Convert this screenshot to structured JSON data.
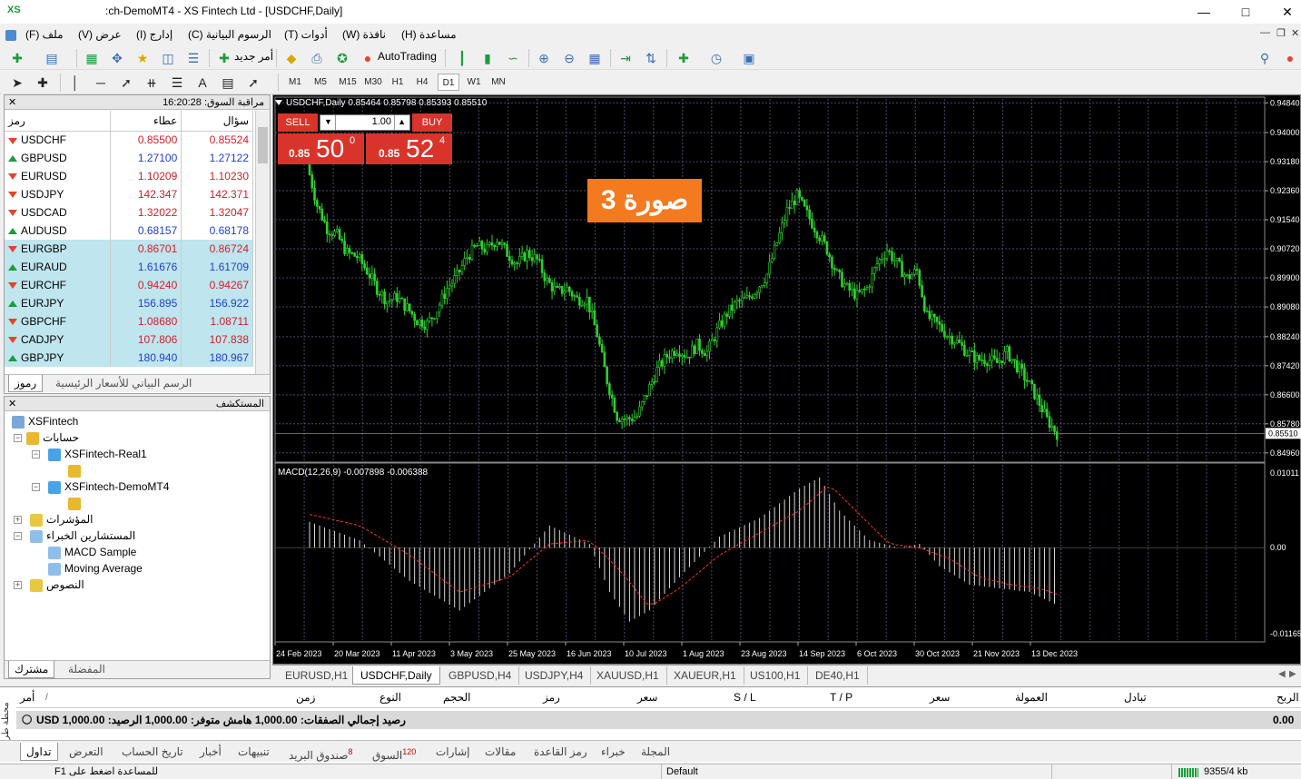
{
  "window": {
    "logo": "XS",
    "title": ":ch-DemoMT4 - XS Fintech Ltd - [USDCHF,Daily]"
  },
  "menu": [
    "ملف (F)",
    "عرض (V)",
    "إدارج (I)",
    "الرسوم البيانية (C)",
    "أدوات (T)",
    "نافذة (W)",
    "مساعدة (H)"
  ],
  "toolbar": {
    "new_order": "أمر جديد",
    "autotrading": "AutoTrading",
    "timeframes": [
      "M1",
      "M5",
      "M15",
      "M30",
      "H1",
      "H4",
      "D1",
      "W1",
      "MN"
    ],
    "active_timeframe": "D1"
  },
  "market_watch": {
    "title": "مراقبة السوق: 16:20:28",
    "headers": {
      "symbol": "رمز",
      "bid": "عطاء",
      "ask": "سؤال"
    },
    "rows": [
      {
        "symbol": "USDCHF",
        "bid": "0.85500",
        "ask": "0.85524",
        "dir": "down",
        "color": "red"
      },
      {
        "symbol": "GBPUSD",
        "bid": "1.27100",
        "ask": "1.27122",
        "dir": "up",
        "color": "blue"
      },
      {
        "symbol": "EURUSD",
        "bid": "1.10209",
        "ask": "1.10230",
        "dir": "down",
        "color": "red"
      },
      {
        "symbol": "USDJPY",
        "bid": "142.347",
        "ask": "142.371",
        "dir": "down",
        "color": "red"
      },
      {
        "symbol": "USDCAD",
        "bid": "1.32022",
        "ask": "1.32047",
        "dir": "down",
        "color": "red"
      },
      {
        "symbol": "AUDUSD",
        "bid": "0.68157",
        "ask": "0.68178",
        "dir": "up",
        "color": "blue"
      },
      {
        "symbol": "EURGBP",
        "bid": "0.86701",
        "ask": "0.86724",
        "dir": "down",
        "color": "red"
      },
      {
        "symbol": "EURAUD",
        "bid": "1.61676",
        "ask": "1.61709",
        "dir": "up",
        "color": "blue"
      },
      {
        "symbol": "EURCHF",
        "bid": "0.94240",
        "ask": "0.94267",
        "dir": "down",
        "color": "red"
      },
      {
        "symbol": "EURJPY",
        "bid": "156.895",
        "ask": "156.922",
        "dir": "up",
        "color": "blue"
      },
      {
        "symbol": "GBPCHF",
        "bid": "1.08680",
        "ask": "1.08711",
        "dir": "down",
        "color": "red"
      },
      {
        "symbol": "CADJPY",
        "bid": "107.806",
        "ask": "107.838",
        "dir": "down",
        "color": "red"
      },
      {
        "symbol": "GBPJPY",
        "bid": "180.940",
        "ask": "180.967",
        "dir": "up",
        "color": "blue"
      }
    ],
    "tabs": [
      "رموز",
      "الرسم البياني للأسعار الرئيسية"
    ]
  },
  "navigator": {
    "title": "المستكشف",
    "root": "XSFintech",
    "accounts": "حسابات",
    "account1": "XSFintech-Real1",
    "account2": "XSFintech-DemoMT4",
    "indicators": "المؤشرات",
    "experts": "المستشارين الخبراء",
    "expert1": "MACD Sample",
    "expert2": "Moving Average",
    "scripts": "النصوص",
    "tabs": [
      "مشترك",
      "المفضلة"
    ]
  },
  "chart": {
    "info": "USDCHF,Daily  0.85464 0.85798 0.85393 0.85510",
    "sell_label": "SELL",
    "buy_label": "BUY",
    "lot": "1.00",
    "sell_prefix": "0.85",
    "sell_big": "50",
    "sell_sup": "0",
    "buy_prefix": "0.85",
    "buy_big": "52",
    "buy_sup": "4",
    "overlay_label": "صورة 3",
    "macd_label": "MACD(12,26,9) -0.007898 -0.006388",
    "current_price": "0.85510"
  },
  "chart_data": {
    "type": "candlestick",
    "symbol": "USDCHF",
    "timeframe": "Daily",
    "price_ticks": [
      "0.94840",
      "0.94000",
      "0.93180",
      "0.92360",
      "0.91540",
      "0.90720",
      "0.89900",
      "0.89080",
      "0.88240",
      "0.87420",
      "0.86600",
      "0.85780",
      "0.84960"
    ],
    "price_range": [
      0.8475,
      0.9495
    ],
    "macd_ticks": [
      "0.01011",
      "0.00",
      "-0.01165"
    ],
    "x_labels": [
      "24 Feb 2023",
      "20 Mar 2023",
      "11 Apr 2023",
      "3 May 2023",
      "25 May 2023",
      "16 Jun 2023",
      "10 Jul 2023",
      "1 Aug 2023",
      "23 Aug 2023",
      "14 Sep 2023",
      "6 Oct 2023",
      "30 Oct 2023",
      "21 Nov 2023",
      "13 Dec 2023"
    ],
    "close_path": [
      [
        0,
        0.931
      ],
      [
        4,
        0.9195
      ],
      [
        8,
        0.913
      ],
      [
        12,
        0.911
      ],
      [
        16,
        0.906
      ],
      [
        20,
        0.905
      ],
      [
        24,
        0.901
      ],
      [
        28,
        0.896
      ],
      [
        32,
        0.8925
      ],
      [
        36,
        0.8935
      ],
      [
        40,
        0.8905
      ],
      [
        44,
        0.887
      ],
      [
        48,
        0.886
      ],
      [
        52,
        0.89
      ],
      [
        56,
        0.896
      ],
      [
        60,
        0.8995
      ],
      [
        64,
        0.905
      ],
      [
        68,
        0.908
      ],
      [
        72,
        0.907
      ],
      [
        76,
        0.91
      ],
      [
        80,
        0.906
      ],
      [
        84,
        0.903
      ],
      [
        88,
        0.906
      ],
      [
        92,
        0.904
      ],
      [
        96,
        0.898
      ],
      [
        100,
        0.895
      ],
      [
        104,
        0.896
      ],
      [
        108,
        0.893
      ],
      [
        112,
        0.893
      ],
      [
        116,
        0.883
      ],
      [
        120,
        0.87
      ],
      [
        124,
        0.86
      ],
      [
        128,
        0.859
      ],
      [
        132,
        0.86
      ],
      [
        136,
        0.8665
      ],
      [
        140,
        0.873
      ],
      [
        144,
        0.877
      ],
      [
        148,
        0.879
      ],
      [
        152,
        0.877
      ],
      [
        156,
        0.88
      ],
      [
        160,
        0.878
      ],
      [
        164,
        0.884
      ],
      [
        168,
        0.889
      ],
      [
        172,
        0.892
      ],
      [
        176,
        0.893
      ],
      [
        180,
        0.896
      ],
      [
        184,
        0.9
      ],
      [
        188,
        0.909
      ],
      [
        192,
        0.918
      ],
      [
        196,
        0.922
      ],
      [
        200,
        0.917
      ],
      [
        204,
        0.912
      ],
      [
        208,
        0.907
      ],
      [
        212,
        0.9
      ],
      [
        216,
        0.896
      ],
      [
        220,
        0.894
      ],
      [
        224,
        0.896
      ],
      [
        228,
        0.903
      ],
      [
        232,
        0.907
      ],
      [
        236,
        0.903
      ],
      [
        240,
        0.899
      ],
      [
        244,
        0.901
      ],
      [
        248,
        0.888
      ],
      [
        252,
        0.886
      ],
      [
        256,
        0.883
      ],
      [
        260,
        0.881
      ],
      [
        264,
        0.878
      ],
      [
        268,
        0.876
      ],
      [
        272,
        0.876
      ],
      [
        276,
        0.875
      ],
      [
        280,
        0.878
      ],
      [
        284,
        0.874
      ],
      [
        288,
        0.87
      ],
      [
        292,
        0.865
      ],
      [
        296,
        0.859
      ],
      [
        300,
        0.8551
      ]
    ],
    "macd_path": [
      [
        0,
        0.0035
      ],
      [
        20,
        0.001
      ],
      [
        40,
        -0.0045
      ],
      [
        60,
        -0.0085
      ],
      [
        80,
        -0.0035
      ],
      [
        96,
        0.003
      ],
      [
        112,
        0.0005
      ],
      [
        120,
        -0.006
      ],
      [
        128,
        -0.01
      ],
      [
        136,
        -0.0085
      ],
      [
        148,
        -0.004
      ],
      [
        164,
        0.0015
      ],
      [
        180,
        0.004
      ],
      [
        196,
        0.008
      ],
      [
        204,
        0.0095
      ],
      [
        212,
        0.005
      ],
      [
        224,
        0.001
      ],
      [
        236,
        0.0
      ],
      [
        244,
        0.0005
      ],
      [
        252,
        -0.0025
      ],
      [
        264,
        -0.005
      ],
      [
        276,
        -0.0055
      ],
      [
        288,
        -0.006
      ],
      [
        300,
        -0.0079
      ]
    ],
    "signal_path": [
      [
        0,
        0.0045
      ],
      [
        20,
        0.003
      ],
      [
        40,
        -0.001
      ],
      [
        60,
        -0.006
      ],
      [
        80,
        -0.004
      ],
      [
        96,
        0.0005
      ],
      [
        112,
        0.001
      ],
      [
        124,
        -0.003
      ],
      [
        136,
        -0.008
      ],
      [
        148,
        -0.0055
      ],
      [
        164,
        -0.001
      ],
      [
        180,
        0.002
      ],
      [
        196,
        0.005
      ],
      [
        208,
        0.0085
      ],
      [
        220,
        0.0045
      ],
      [
        232,
        0.0005
      ],
      [
        244,
        0.0
      ],
      [
        256,
        -0.0015
      ],
      [
        268,
        -0.004
      ],
      [
        280,
        -0.005
      ],
      [
        292,
        -0.0055
      ],
      [
        300,
        -0.0064
      ]
    ]
  },
  "chart_tabs": [
    "EURUSD,H1",
    "USDCHF,Daily",
    "GBPUSD,H4",
    "USDJPY,H4",
    "XAUUSD,H1",
    "XAUEUR,H1",
    "US100,H1",
    "DE40,H1"
  ],
  "active_chart_tab": "USDCHF,Daily",
  "terminal": {
    "headers": [
      "أمر",
      "زمن",
      "النوع",
      "الحجم",
      "رمز",
      "سعر",
      "S / L",
      "T / P",
      "سعر",
      "العمولة",
      "تبادل",
      "الربح"
    ],
    "balance_text": "رصيد إجمالي الصفقات: 1,000.00  هامش متوفر: 1,000.00  الرصيد: USD 1,000.00",
    "profit": "0.00",
    "side_label": "محطة طرفية",
    "tabs": [
      "تداول",
      "التعرض",
      "تاريخ الحساب",
      "أخبار",
      "تنبيهات",
      "صندوق البريد",
      "السوق",
      "إشارات",
      "مقالات",
      "رمز القاعدة",
      "خبراء",
      "المجلة"
    ],
    "mailbox_badge": "8",
    "market_badge": "120"
  },
  "status": {
    "help": "للمساعدة اضغط على F1",
    "profile": "Default",
    "traffic": "9355/4 kb"
  },
  "colors": {
    "bull": "#33cc33",
    "bear": "#33cc33",
    "grid": "#3a3a5a",
    "macd_hist": "#d0d0d0",
    "signal": "#ff3b3b"
  }
}
